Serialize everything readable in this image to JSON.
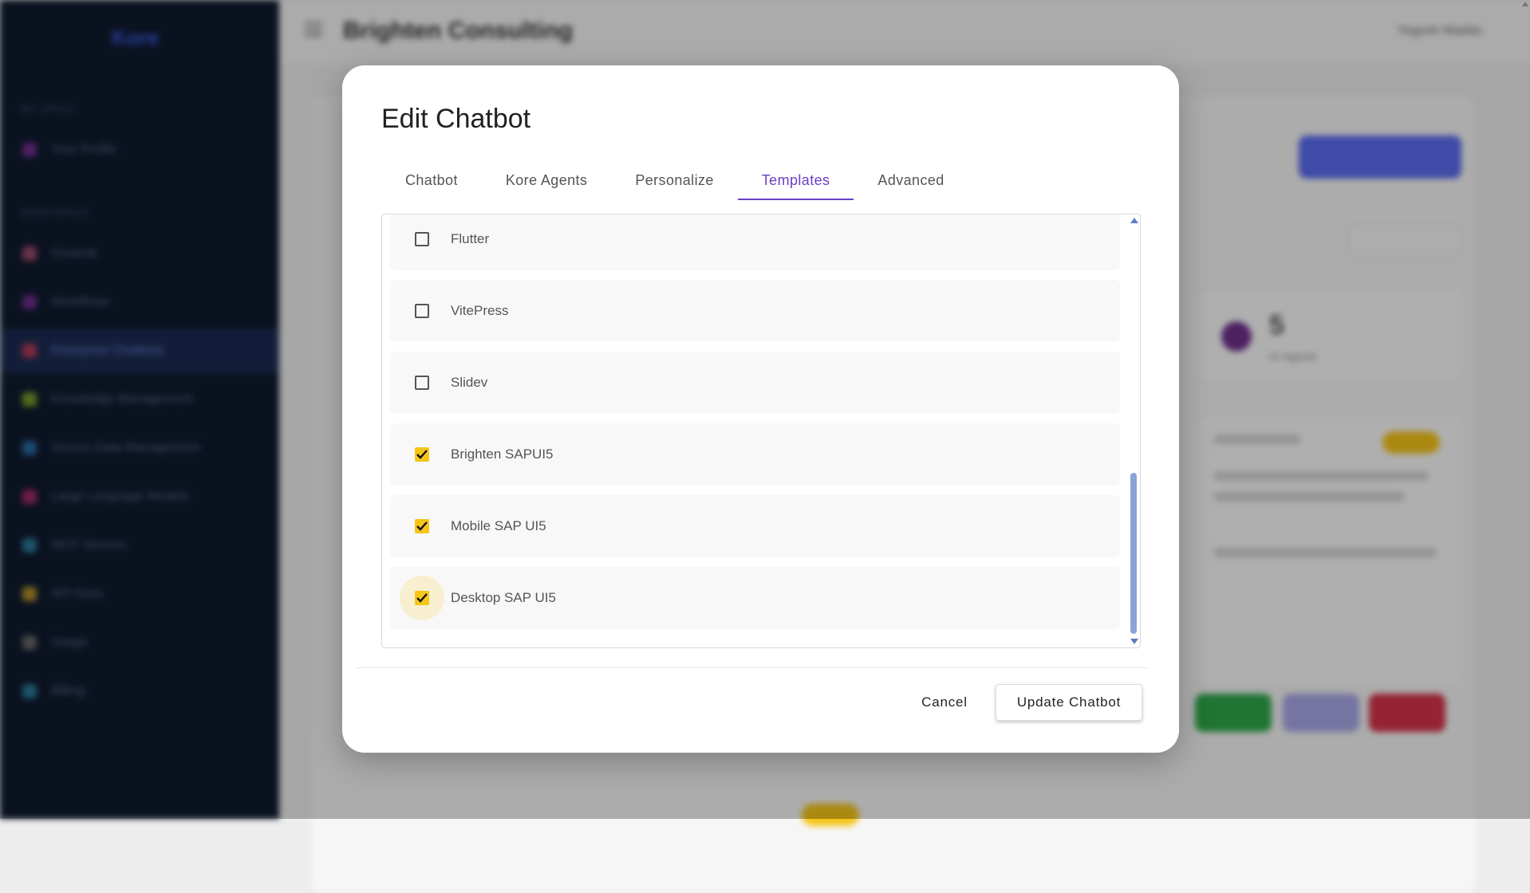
{
  "background": {
    "app_logo": "Kore",
    "sidebar_sections": [
      "MY SPACE",
      "WORKSPACE"
    ],
    "sidebar_items": [
      {
        "label": "Your Profile",
        "color": "#6e2f8c"
      },
      {
        "label": "General",
        "color": "#9b4a6a"
      },
      {
        "label": "Workflows",
        "color": "#6e2f8c"
      },
      {
        "label": "Enterprise Chatbots",
        "color": "#b03a5a"
      },
      {
        "label": "Knowledge Management",
        "color": "#7a9a2a"
      },
      {
        "label": "Secure Data Management",
        "color": "#2a6aa0"
      },
      {
        "label": "Large Language Models",
        "color": "#a02a6a"
      },
      {
        "label": "MCP Servers",
        "color": "#2a7a9a"
      },
      {
        "label": "API Keys",
        "color": "#b0902a"
      },
      {
        "label": "Usage",
        "color": "#666666"
      },
      {
        "label": "Billing",
        "color": "#2a7a9a"
      }
    ],
    "page_title": "Brighten Consulting",
    "user_name": "Yogesh Maddu",
    "stat_number": "5",
    "stat_label": "AI Agents"
  },
  "dialog": {
    "title": "Edit Chatbot",
    "tabs": [
      {
        "label": "Chatbot",
        "active": false
      },
      {
        "label": "Kore Agents",
        "active": false
      },
      {
        "label": "Personalize",
        "active": false
      },
      {
        "label": "Templates",
        "active": true
      },
      {
        "label": "Advanced",
        "active": false
      }
    ],
    "templates": [
      {
        "label": "Flutter",
        "checked": false
      },
      {
        "label": "VitePress",
        "checked": false
      },
      {
        "label": "Slidev",
        "checked": false
      },
      {
        "label": "Brighten SAPUI5",
        "checked": true
      },
      {
        "label": "Mobile SAP UI5",
        "checked": true
      },
      {
        "label": "Desktop SAP UI5",
        "checked": true
      }
    ],
    "cancel_label": "Cancel",
    "update_label": "Update Chatbot",
    "accent_color": "#6b3fc4",
    "checkbox_color": "#f5c518"
  }
}
